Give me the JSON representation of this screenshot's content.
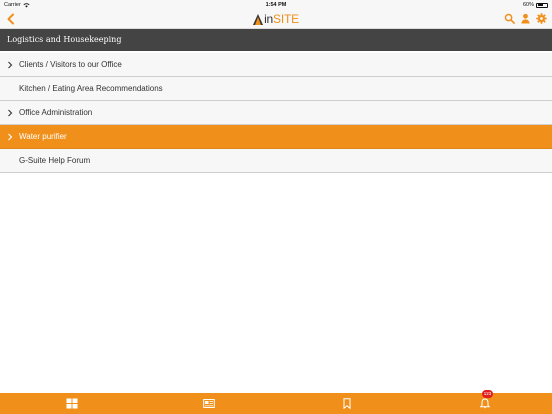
{
  "status_bar": {
    "carrier": "Carrier",
    "time": "1:54 PM",
    "battery_percent": "60%",
    "battery_level": 0.6
  },
  "nav_bar": {
    "logo": {
      "prefix": "in",
      "suffix": "SITE"
    },
    "icons": [
      "back-chevron-icon",
      "search-icon",
      "user-icon",
      "gear-icon"
    ]
  },
  "section": {
    "title": "Logistics and Housekeeping"
  },
  "list": {
    "items": [
      {
        "label": "Clients / Visitors to our Office",
        "has_chevron": true,
        "active": false
      },
      {
        "label": "Kitchen / Eating Area Recommendations",
        "has_chevron": false,
        "active": false
      },
      {
        "label": "Office Administration",
        "has_chevron": true,
        "active": false
      },
      {
        "label": "Water purifier",
        "has_chevron": true,
        "active": true
      },
      {
        "label": "G-Suite Help Forum",
        "has_chevron": false,
        "active": false
      }
    ]
  },
  "tab_bar": {
    "tabs": [
      "grid-icon",
      "news-icon",
      "bookmark-icon",
      "bell-icon"
    ],
    "notification_count": "123"
  },
  "colors": {
    "accent": "#f0901a",
    "header": "#444444",
    "badge": "#e02020"
  }
}
